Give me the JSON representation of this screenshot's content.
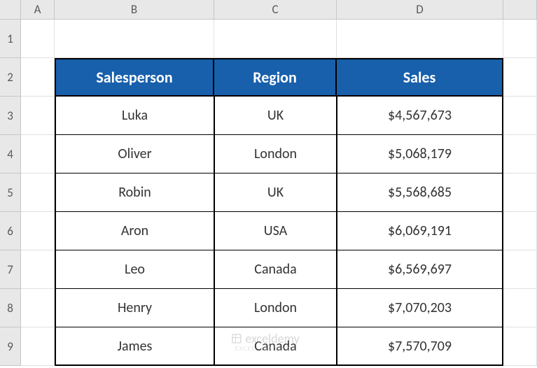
{
  "columns": [
    "",
    "A",
    "B",
    "C",
    "D",
    ""
  ],
  "rows": [
    "1",
    "2",
    "3",
    "4",
    "5",
    "6",
    "7",
    "8",
    "9"
  ],
  "headers": {
    "salesperson": "Salesperson",
    "region": "Region",
    "sales": "Sales"
  },
  "data": [
    {
      "salesperson": "Luka",
      "region": "UK",
      "sales": "$4,567,673"
    },
    {
      "salesperson": "Oliver",
      "region": "London",
      "sales": "$5,068,179"
    },
    {
      "salesperson": "Robin",
      "region": "UK",
      "sales": "$5,568,685"
    },
    {
      "salesperson": "Aron",
      "region": "USA",
      "sales": "$6,069,191"
    },
    {
      "salesperson": "Leo",
      "region": "Canada",
      "sales": "$6,569,697"
    },
    {
      "salesperson": "Henry",
      "region": "London",
      "sales": "$7,070,203"
    },
    {
      "salesperson": "James",
      "region": "Canada",
      "sales": "$7,570,709"
    }
  ],
  "watermark": {
    "text": "exceldemy",
    "sub": "EXCEL · DATA · BI"
  }
}
